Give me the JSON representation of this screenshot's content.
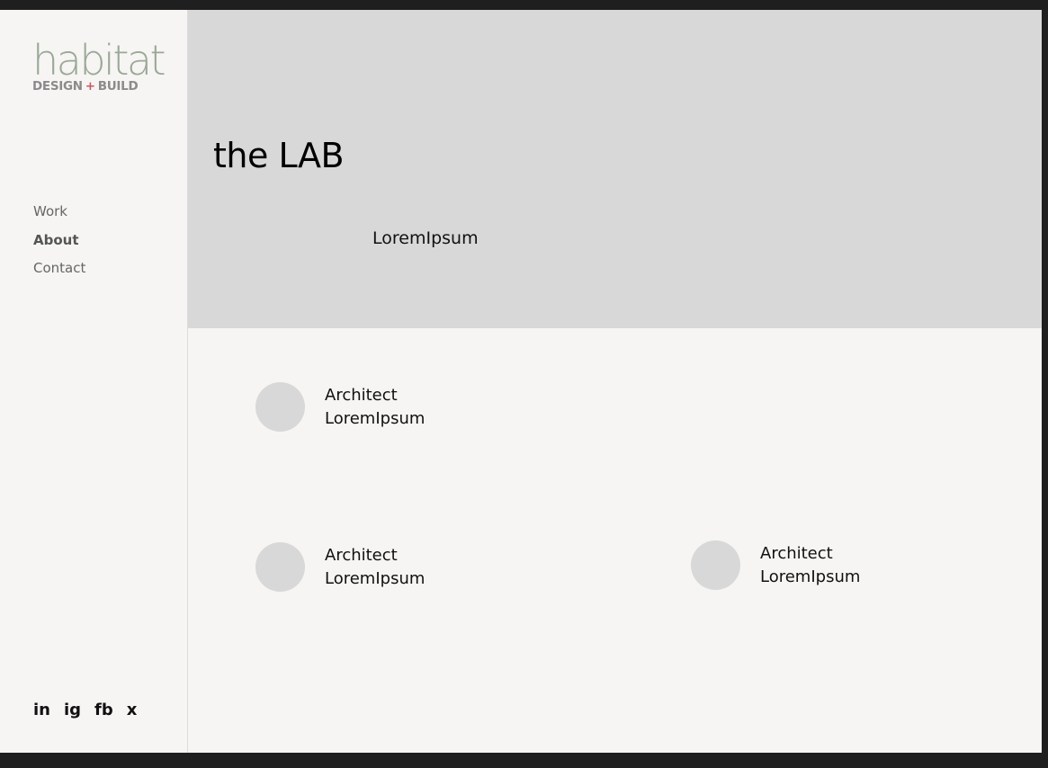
{
  "logo": {
    "word": "habitat",
    "sub_left": "DESIGN",
    "sub_plus": "+",
    "sub_right": "BUILD"
  },
  "nav": {
    "items": [
      {
        "label": "Work",
        "active": false
      },
      {
        "label": "About",
        "active": true
      },
      {
        "label": "Contact",
        "active": false
      }
    ]
  },
  "social": {
    "items": [
      "in",
      "ig",
      "fb",
      "x"
    ]
  },
  "hero": {
    "title": "the LAB",
    "subtitle": "LoremIpsum"
  },
  "team": [
    {
      "role": "Architect",
      "name": "LoremIpsum"
    },
    {
      "role": "Architect",
      "name": "LoremIpsum"
    },
    {
      "role": "Architect",
      "name": "LoremIpsum"
    }
  ],
  "colors": {
    "logo_word": "#9aa896",
    "logo_plus": "#c65a60",
    "hero_bg": "#d8d8d8",
    "page_bg": "#f6f5f3",
    "outer_bg": "#1f1f1f"
  }
}
